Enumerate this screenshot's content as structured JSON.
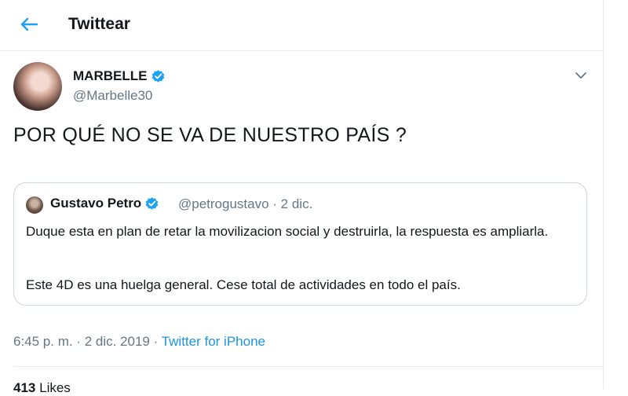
{
  "header": {
    "title": "Twittear",
    "back_icon": "arrow-left-icon"
  },
  "tweet": {
    "author_name": "MARBELLE",
    "author_handle": "@Marbelle30",
    "text": "POR QUÉ NO SE VA DE NUESTRO PAÍS ?",
    "timestamp": "6:45 p. m. · 2 dic. 2019",
    "separator": " · ",
    "source": "Twitter for iPhone"
  },
  "quoted_tweet": {
    "author_name": "Gustavo Petro",
    "handle_and_date": "@petrogustavo · 2 dic.",
    "text_line1": "Duque esta en plan de retar la movilizacion social y destruirla, la respuesta es ampliarla.",
    "text_line2": "Este 4D es una huelga general. Cese total de actividades en todo el país."
  },
  "stats": {
    "count": "413",
    "label": "Likes"
  },
  "colors": {
    "accent": "#1da1f2",
    "link": "#1b95e0",
    "secondary_text": "#657786",
    "border": "#e6ecf0"
  }
}
